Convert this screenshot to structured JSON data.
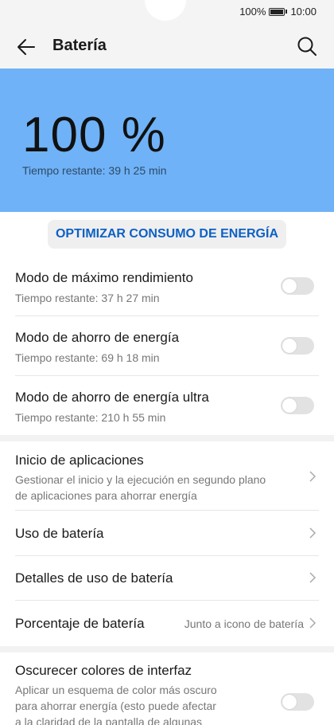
{
  "status": {
    "battery": "100%",
    "time": "10:00"
  },
  "header": {
    "title": "Batería"
  },
  "hero": {
    "percent": "100 %",
    "remaining": "Tiempo restante: 39 h 25 min"
  },
  "optimize_label": "OPTIMIZAR CONSUMO DE ENERGÍA",
  "modes": [
    {
      "title": "Modo de máximo rendimiento",
      "subtitle": "Tiempo restante: 37 h 27 min",
      "enabled": false
    },
    {
      "title": "Modo de ahorro de energía",
      "subtitle": "Tiempo restante: 69 h 18 min",
      "enabled": false
    },
    {
      "title": "Modo de ahorro de energía ultra",
      "subtitle": "Tiempo restante: 210 h 55 min",
      "enabled": false
    }
  ],
  "settings": {
    "app_launch": {
      "title": "Inicio de aplicaciones",
      "subtitle_line1": "Gestionar el inicio y la ejecución en segundo plano",
      "subtitle_line2": "de aplicaciones para ahorrar energía"
    },
    "battery_usage": {
      "title": "Uso de batería"
    },
    "usage_details": {
      "title": "Detalles de uso de batería"
    },
    "battery_percentage": {
      "title": "Porcentaje de batería",
      "value": "Junto a icono de batería"
    }
  },
  "dark_colors": {
    "title": "Oscurecer colores de interfaz",
    "line1": "Aplicar un esquema de color más oscuro",
    "line2": "para ahorrar energía (esto puede afectar",
    "line3": "a la claridad de la pantalla de algunas",
    "enabled": false
  },
  "colors": {
    "hero_bg": "#6fb2f7",
    "accent": "#0d61c4"
  }
}
